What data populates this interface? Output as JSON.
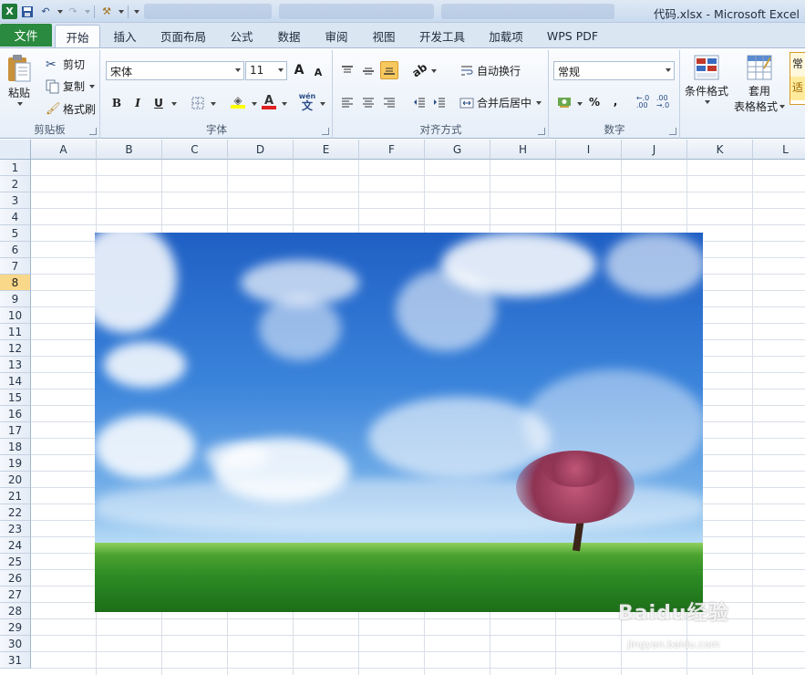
{
  "window": {
    "title": "代码.xlsx - Microsoft Excel"
  },
  "ribbon_tabs": [
    "文件",
    "开始",
    "插入",
    "页面布局",
    "公式",
    "数据",
    "审阅",
    "视图",
    "开发工具",
    "加载项",
    "WPS PDF"
  ],
  "clipboard": {
    "paste": "粘贴",
    "cut": "剪切",
    "copy": "复制",
    "format_painter": "格式刷",
    "group_label": "剪贴板"
  },
  "font": {
    "name": "宋体",
    "size": "11",
    "bold": "B",
    "italic": "I",
    "underline": "U",
    "group_label": "字体",
    "grow": "A",
    "shrink": "A",
    "font_color": "A",
    "phonetic": "wén"
  },
  "alignment": {
    "wrap_text": "自动换行",
    "merge_center": "合并后居中",
    "group_label": "对齐方式"
  },
  "number": {
    "format": "常规",
    "percent": "%",
    "comma": ",",
    "group_label": "数字"
  },
  "styles": {
    "conditional": "条件格式",
    "table_format_line1": "套用",
    "table_format_line2": "表格格式",
    "cell_style": "常",
    "cell_style2": "适"
  },
  "columns": [
    "A",
    "B",
    "C",
    "D",
    "E",
    "F",
    "G",
    "H",
    "I",
    "J",
    "K",
    "L"
  ],
  "rows": [
    "1",
    "2",
    "3",
    "4",
    "5",
    "6",
    "7",
    "8",
    "9",
    "10",
    "11",
    "12",
    "13",
    "14",
    "15",
    "16",
    "17",
    "18",
    "19",
    "20",
    "21",
    "22",
    "23",
    "24",
    "25",
    "26",
    "27",
    "28",
    "29",
    "30",
    "31"
  ],
  "selected_row": "8",
  "watermark": {
    "logo": "Baidu经验",
    "url": "jingyan.baidu.com"
  }
}
